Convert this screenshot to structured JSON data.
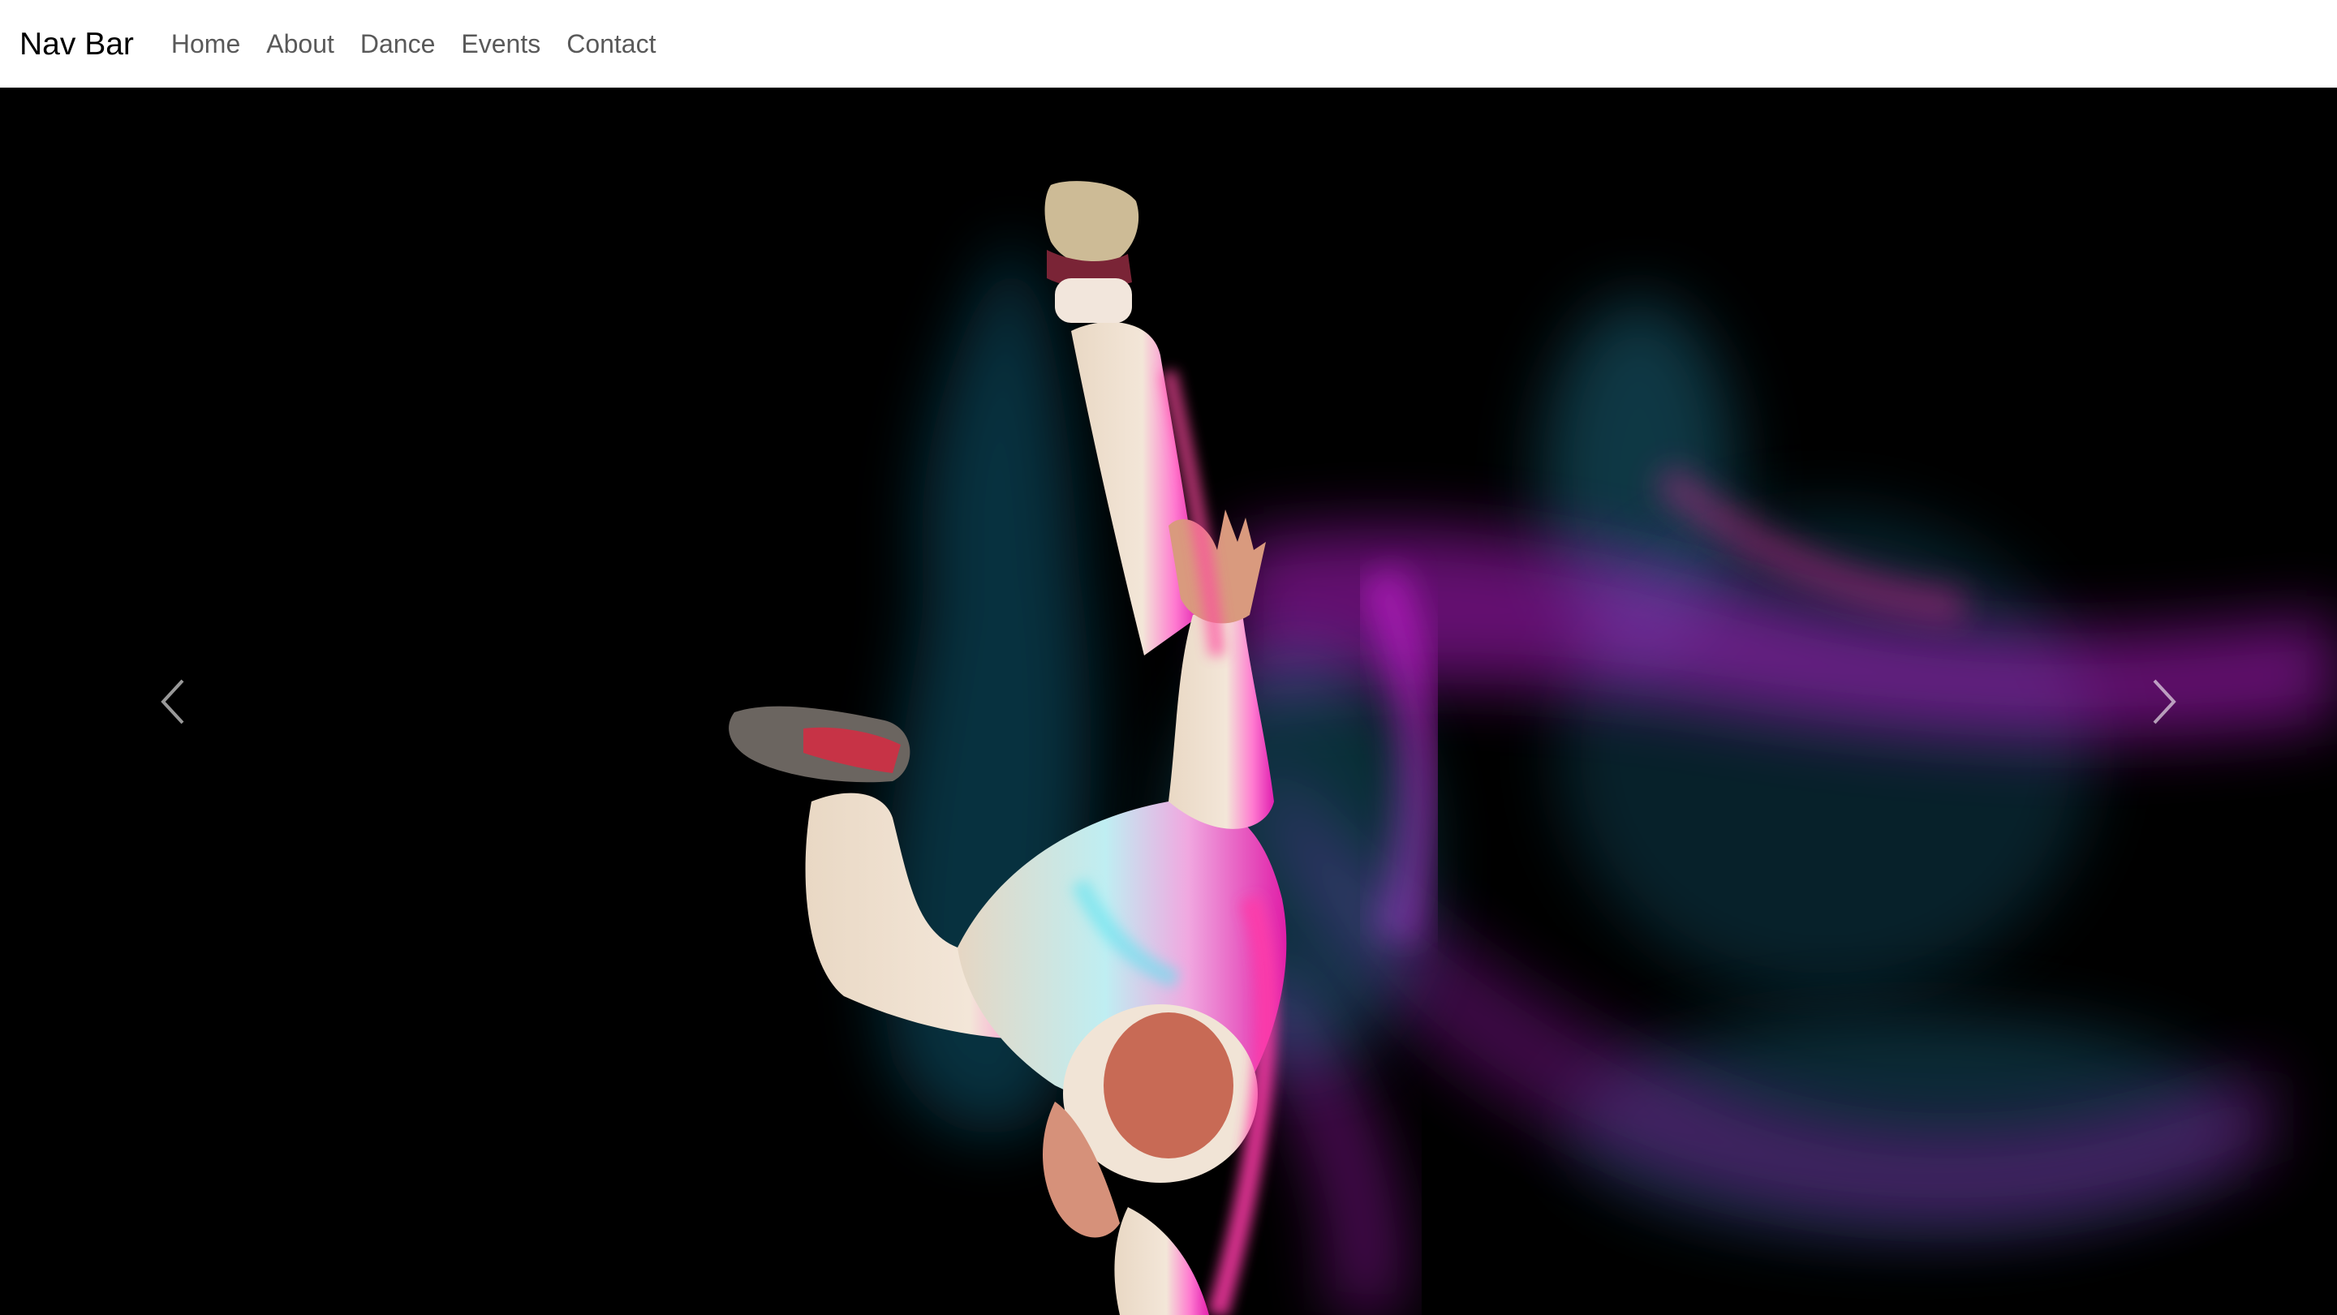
{
  "navbar": {
    "brand": "Nav Bar",
    "links": [
      {
        "label": "Home"
      },
      {
        "label": "About"
      },
      {
        "label": "Dance"
      },
      {
        "label": "Events"
      },
      {
        "label": "Contact"
      }
    ]
  },
  "carousel": {
    "slide_image": "breakdancer-handstand-neon-motion-blur",
    "prev_icon": "chevron-left-icon",
    "next_icon": "chevron-right-icon"
  },
  "colors": {
    "navbar_bg": "#ffffff",
    "hero_bg": "#000000",
    "accent_magenta": "#c21fd1",
    "accent_teal": "#1f8aa8",
    "accent_pink": "#ff3aa8"
  }
}
